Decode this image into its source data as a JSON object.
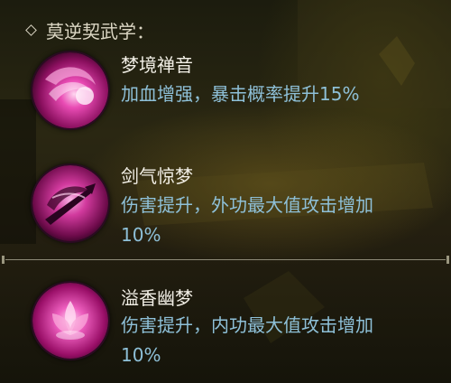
{
  "section": {
    "title": "莫逆契武学："
  },
  "skills": [
    {
      "name": "梦境禅音",
      "desc_lines": [
        "加血增强，暴击概率提升15%"
      ],
      "icon": "swirl-orb-icon"
    },
    {
      "name": "剑气惊梦",
      "desc_lines": [
        "伤害提升，外功最大值攻击增加",
        "10%"
      ],
      "icon": "sword-orb-icon"
    },
    {
      "name": "溢香幽梦",
      "desc_lines": [
        "伤害提升，内功最大值攻击增加",
        "10%"
      ],
      "icon": "lotus-orb-icon"
    }
  ],
  "colors": {
    "name": "#f2efe6",
    "desc": "#8ec0d8",
    "header": "#dcd7c4",
    "orb": "#c8248c"
  }
}
